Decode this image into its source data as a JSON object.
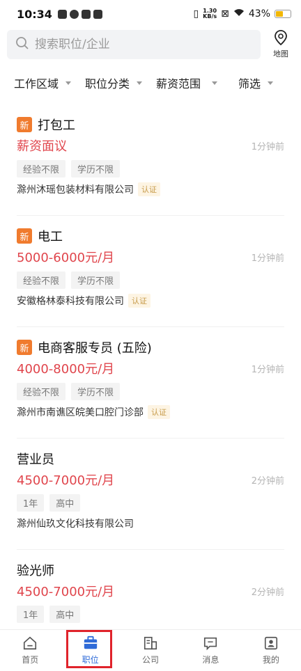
{
  "status": {
    "time": "10:34",
    "speed_top": "1.30",
    "speed_bottom": "KB/s",
    "battery": "43%"
  },
  "search": {
    "placeholder": "搜索职位/企业",
    "map_label": "地图"
  },
  "filters": [
    "工作区域",
    "职位分类",
    "薪资范围",
    "筛选"
  ],
  "jobs": [
    {
      "new": "新",
      "title": "打包工",
      "salary": "薪资面议",
      "time": "1分钟前",
      "tags": [
        "经验不限",
        "学历不限"
      ],
      "company": "滁州沐瑶包装材料有限公司",
      "verified": "认证"
    },
    {
      "new": "新",
      "title": "电工",
      "salary": "5000-6000元/月",
      "time": "1分钟前",
      "tags": [
        "经验不限",
        "学历不限"
      ],
      "company": "安徽格林泰科技有限公司",
      "verified": "认证"
    },
    {
      "new": "新",
      "title": "电商客服专员 (五险)",
      "salary": "4000-8000元/月",
      "time": "1分钟前",
      "tags": [
        "经验不限",
        "学历不限"
      ],
      "company": "滁州市南谯区皖美口腔门诊部",
      "verified": "认证"
    },
    {
      "new": "",
      "title": "营业员",
      "salary": "4500-7000元/月",
      "time": "2分钟前",
      "tags": [
        "1年",
        "高中"
      ],
      "company": "滁州仙玖文化科技有限公司",
      "verified": ""
    },
    {
      "new": "",
      "title": "验光师",
      "salary": "4500-7000元/月",
      "time": "2分钟前",
      "tags": [
        "1年",
        "高中"
      ],
      "company": "",
      "verified": ""
    }
  ],
  "tabs": [
    {
      "label": "首页",
      "icon": "home-icon"
    },
    {
      "label": "职位",
      "icon": "briefcase-icon"
    },
    {
      "label": "公司",
      "icon": "building-icon"
    },
    {
      "label": "消息",
      "icon": "message-icon"
    },
    {
      "label": "我的",
      "icon": "profile-icon"
    }
  ],
  "colors": {
    "accent": "#2f6bd8",
    "salary": "#e0454c",
    "new_badge": "#f07b2e",
    "highlight": "#e0232b"
  }
}
